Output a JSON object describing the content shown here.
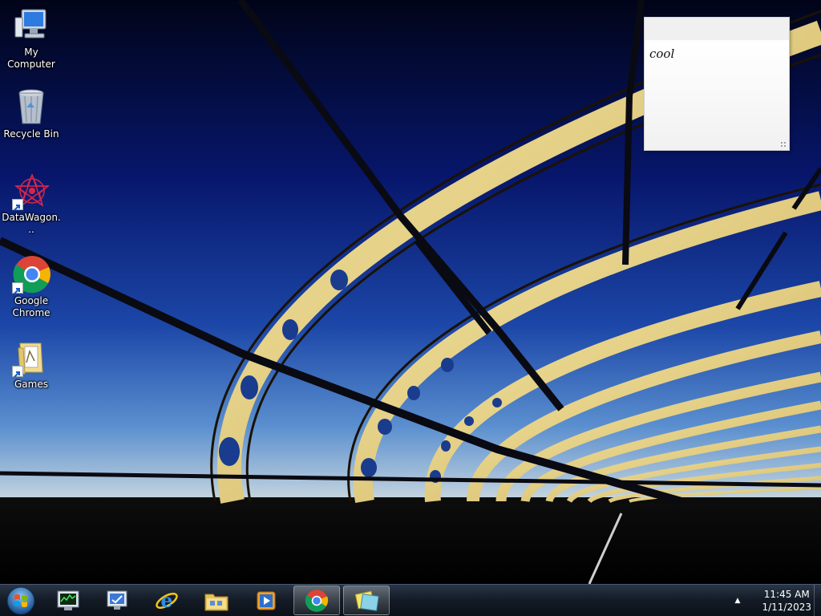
{
  "desktop": {
    "icons": [
      {
        "label": "My Computer",
        "icon": "computer-icon"
      },
      {
        "label": "Recycle Bin",
        "icon": "recycle-bin-icon"
      },
      {
        "label": "DataWagon...",
        "icon": "datawagon-icon",
        "shortcut": true
      },
      {
        "label": "Google Chrome",
        "icon": "chrome-icon",
        "shortcut": true
      },
      {
        "label": "Games",
        "icon": "games-folder-icon",
        "shortcut": true
      }
    ]
  },
  "sticky_note": {
    "text": "cool"
  },
  "taskbar": {
    "start_icon": "windows-start-orb-icon",
    "pinned": [
      {
        "name": "task-manager",
        "icon": "task-manager-icon",
        "active": false
      },
      {
        "name": "remote-desktop",
        "icon": "remote-desktop-icon",
        "active": false
      },
      {
        "name": "internet-explorer",
        "icon": "internet-explorer-icon",
        "active": false
      },
      {
        "name": "windows-explorer",
        "icon": "file-explorer-icon",
        "active": false
      },
      {
        "name": "media-player",
        "icon": "media-player-icon",
        "active": false
      },
      {
        "name": "google-chrome",
        "icon": "chrome-icon",
        "active": true
      },
      {
        "name": "sticky-notes",
        "icon": "sticky-notes-icon",
        "active": true
      }
    ],
    "tray": {
      "arrow": "▲",
      "time": "11:45 AM",
      "date": "1/11/2023"
    }
  },
  "colors": {
    "sky_top": "#02071f",
    "sky_bottom": "#4a7fc0",
    "bridge": "#e8d48a",
    "taskbar": "#141c27"
  }
}
